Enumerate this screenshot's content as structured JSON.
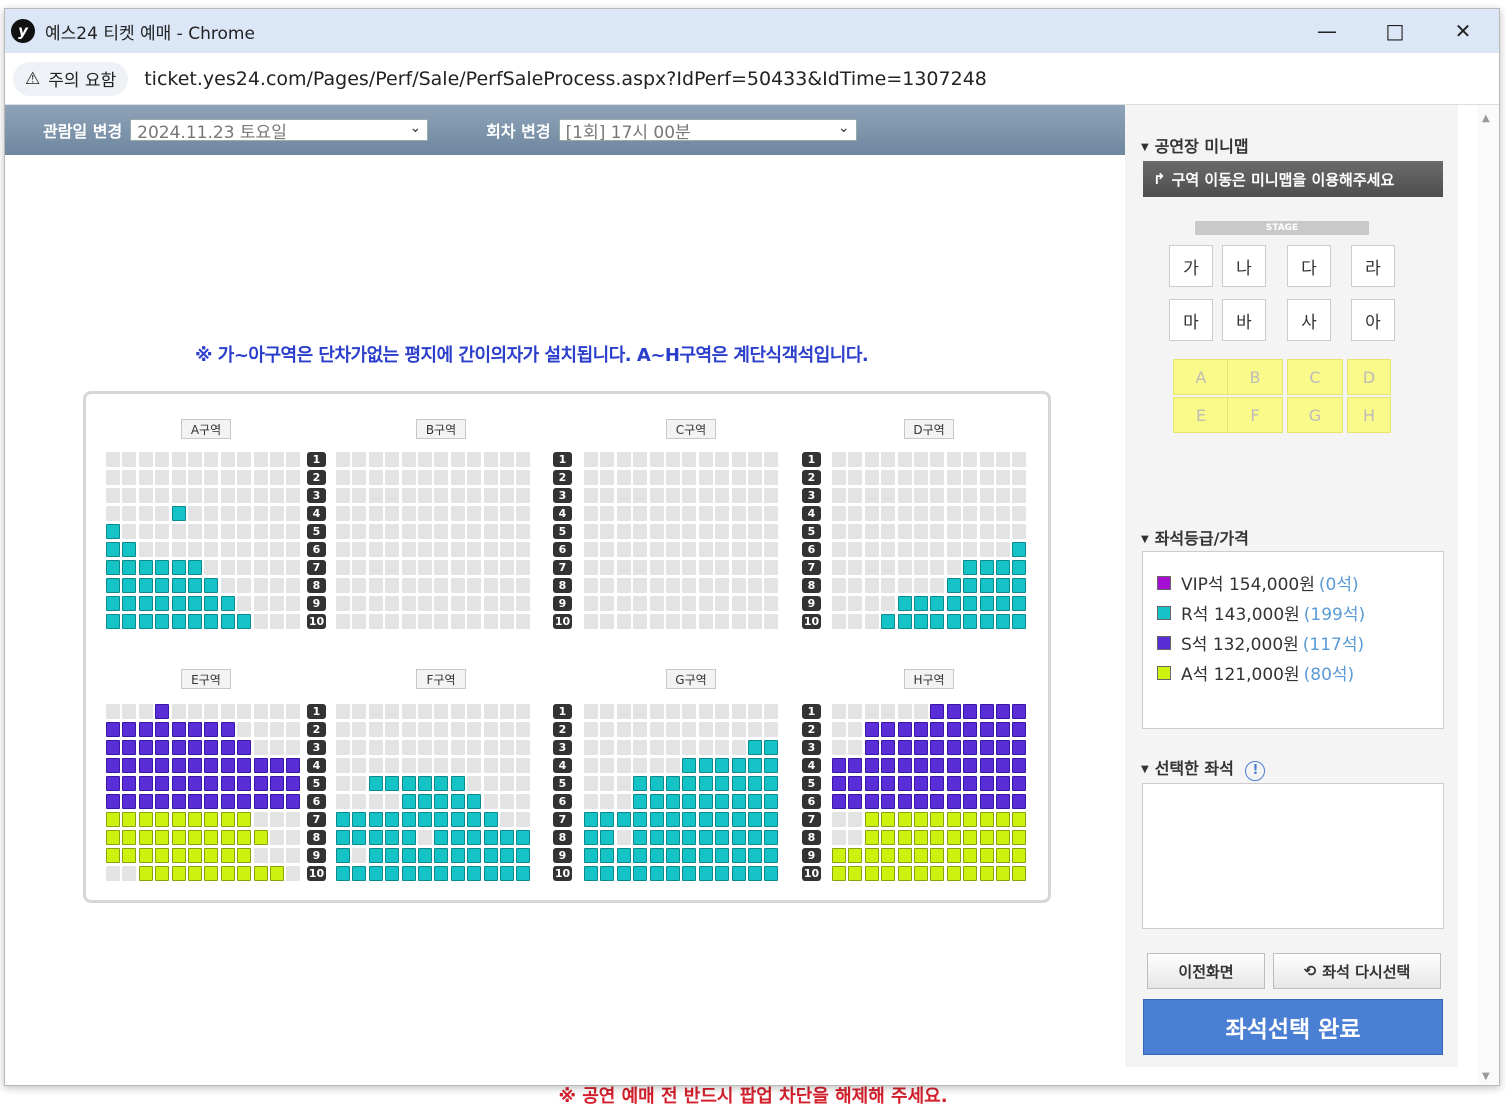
{
  "underlay": {
    "warning": "※ 공연 예매 전 반드시 팝업 차단을 해제해 주세요."
  },
  "window": {
    "logo": "y",
    "title": "예스24 티켓 예매 - Chrome",
    "security_label": "주의 요함",
    "url": "ticket.yes24.com/Pages/Perf/Sale/PerfSaleProcess.aspx?IdPerf=50433&IdTime=1307248"
  },
  "topbar": {
    "date_label": "관람일 변경",
    "date_value": "2024.11.23 토요일",
    "time_label": "회차 변경",
    "time_value": "[1회] 17시 00분"
  },
  "notice": "※ 가~아구역은 단차가없는 평지에 간이의자가 설치됩니다. A~H구역은 계단식객석입니다.",
  "sections": {
    "top": [
      "A구역",
      "B구역",
      "C구역",
      "D구역"
    ],
    "bottom": [
      "E구역",
      "F구역",
      "G구역",
      "H구역"
    ]
  },
  "row_numbers": [
    "1",
    "2",
    "3",
    "4",
    "5",
    "6",
    "7",
    "8",
    "9",
    "10"
  ],
  "seatmap": {
    "cols": 12,
    "top": [
      [
        "............",
        "............",
        "............",
        "............",
        "............",
        "............",
        "............",
        "............",
        "............",
        "............"
      ],
      [
        "............",
        "............",
        "............",
        "............",
        "............",
        "............",
        "............",
        "............",
        "............",
        "............"
      ],
      [
        "............",
        "............",
        "............",
        "............",
        "............",
        "............",
        "............",
        "............",
        "............",
        "............"
      ],
      [
        "............",
        "............",
        "............",
        "............",
        "............",
        "............",
        "............",
        "............",
        "............",
        "............"
      ],
      [
        "............",
        "............",
        "............",
        "............",
        "............",
        "............",
        "............",
        "............",
        "............",
        "............"
      ],
      [
        "............",
        "............",
        "............",
        "............",
        "............",
        "............",
        "............",
        "............",
        "............",
        "............"
      ],
      [
        "............",
        "............",
        "............",
        "............",
        "............",
        "............",
        "............",
        "............",
        "............",
        "............"
      ],
      [
        "............",
        "............",
        "............",
        "............",
        "............",
        "............",
        "............",
        "............",
        "............",
        "............"
      ],
      [
        "............",
        "............",
        "............",
        "............",
        "............",
        "............",
        "............",
        "............",
        "............",
        "............"
      ],
      [
        "............",
        "............",
        "............",
        "............",
        "............",
        "............",
        "............",
        "............",
        "............",
        "............"
      ]
    ],
    "bottom": [
      [
        "............",
        "............",
        "............",
        "............",
        "............",
        "............",
        "............",
        "............",
        "............",
        "............"
      ],
      [
        "............",
        "............",
        "............",
        "............",
        "............",
        "............",
        "............",
        "............",
        "............",
        "............"
      ],
      [
        "............",
        "............",
        "............",
        "............",
        "............",
        "............",
        "............",
        "............",
        "............",
        "............"
      ],
      [
        "............",
        "............",
        "............",
        "............",
        "............",
        "............",
        "............",
        "............",
        "............",
        "............"
      ],
      [
        "............",
        "............",
        "............",
        "............",
        "............",
        "............",
        "............",
        "............",
        "............",
        "............"
      ],
      [
        "............",
        "............",
        "............",
        "............",
        "............",
        "............",
        "............",
        "............",
        "............",
        "............"
      ],
      [
        "............",
        "............",
        "............",
        "............",
        "............",
        "............",
        "............",
        "............",
        "............",
        "............"
      ],
      [
        "............",
        "............",
        "............",
        "............",
        "............",
        "............",
        "............",
        "............",
        "............",
        "............"
      ],
      [
        "............",
        "............",
        "............",
        "............",
        "............",
        "............",
        "............",
        "............",
        "............",
        "............"
      ],
      [
        "............",
        "............",
        "............",
        "............",
        "............",
        "............",
        "............",
        "............",
        "............",
        "............"
      ]
    ]
  },
  "seat_rows": {
    "A": [
      "............",
      "............",
      "............",
      "....R.......",
      "R...........",
      "RR..........",
      "RRRRRR......",
      "RRRRRRR.....",
      "RRRRRRRR....",
      "RRRRRRRRR..."
    ],
    "B": [
      "............",
      "............",
      "............",
      "............",
      "............",
      "............",
      "............",
      "............",
      "............",
      "............"
    ],
    "C": [
      "............",
      "............",
      "............",
      "............",
      "............",
      "............",
      "............",
      "............",
      "............",
      "............"
    ],
    "D": [
      "............",
      "............",
      "............",
      "............",
      "............",
      "...........R",
      "........RRRR",
      ".......RRRRR",
      "....RRRRRRRR",
      "...RRRRRRRRR"
    ],
    "E": [
      "...S........",
      "SSSSSSSS....",
      "SSSSSSSSS...",
      "SSSSSSSSSSSS",
      "SSSSSSSSSSSS",
      "SSSSSSSSSSSS",
      "AAAAAAAAA...",
      "AAAAAAAAAA..",
      "AAAAAAAAA...",
      "..AAAAAAAAA."
    ],
    "F": [
      "............",
      "............",
      "............",
      "............",
      "..RRRRRR....",
      "....RRRRR...",
      "RRRRRRRRRR..",
      "RRRRR.RRRRRR",
      "R.RRRRRRRRRR",
      "RRRRRRRRRRRR"
    ],
    "G": [
      "............",
      "............",
      "..........RR",
      "......RRRRRR",
      "...RRRRRRRRR",
      "...RRRRRRRRR",
      "RRRRRRRRRRRR",
      "RR.RRRRRRRRR",
      "RRRRRRRRRRRR",
      "RRRRRRRRRRRR"
    ],
    "H": [
      "......SSSSSS",
      "..SSSSSSSSSS",
      "..SSSSSSSSSS",
      "SSSSSSSSSSSS",
      "SSSSSSSSSSSS",
      "SSSSSSSSSSSS",
      "..AAAAAAAAAA",
      "..AAAAAAAAAA",
      "AAAAAAAAAAAA",
      "AAAAAAAAAAAA"
    ]
  },
  "sidebar": {
    "minimap_title": "공연장 미니맵",
    "minimap_button": "구역 이동은 미니맵을 이용해주세요",
    "stage_label": "STAGE",
    "floor_zones": [
      "가",
      "나",
      "다",
      "라",
      "마",
      "바",
      "사",
      "아"
    ],
    "tier_zones": [
      "A",
      "B",
      "C",
      "D",
      "E",
      "F",
      "G",
      "H"
    ],
    "grade_title": "좌석등급/가격",
    "grades": [
      {
        "name": "VIP석",
        "price": "154,000원",
        "count": "(0석)",
        "color": "#a50fd1"
      },
      {
        "name": "R석",
        "price": "143,000원",
        "count": "(199석)",
        "color": "#15c3c6"
      },
      {
        "name": "S석",
        "price": "132,000원",
        "count": "(117석)",
        "color": "#5a2ed6"
      },
      {
        "name": "A석",
        "price": "121,000원",
        "count": "(80석)",
        "color": "#cdf20f"
      }
    ],
    "selected_title": "선택한 좌석",
    "prev_button": "이전화면",
    "reselect_button": "좌석 다시선택",
    "complete_button": "좌석선택 완료"
  }
}
